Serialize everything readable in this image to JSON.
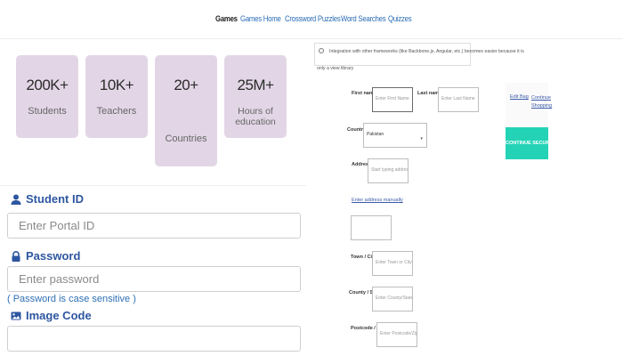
{
  "nav": {
    "links": [
      "Games",
      "Games Home",
      "Crossword Puzzles",
      "Word Searches",
      "Quizzes"
    ]
  },
  "stats": [
    {
      "value": "200K+",
      "label": "Students"
    },
    {
      "value": "10K+",
      "label": "Teachers"
    },
    {
      "value": "20+",
      "label": "Countries"
    },
    {
      "value": "25M+",
      "label": "Hours of education"
    }
  ],
  "login": {
    "student_id_label": "Student ID",
    "student_id_placeholder": "Enter Portal ID",
    "password_label": "Password",
    "password_placeholder": "Enter password",
    "password_hint": "( Password is case sensitive )",
    "image_code_label": "Image Code",
    "image_code_value": ""
  },
  "checkout": {
    "note_line1": "Integration with other frameworks (like Backbone.js, Angular, etc.) becomes easier because it is",
    "note_line2": "only a view library",
    "first_name_label": "First name *",
    "first_name_placeholder": "Enter First Name",
    "last_name_label": "Last name *",
    "last_name_placeholder": "Enter Last Name",
    "edit_bag": "Edit Bag",
    "continue_shopping": "Continue Shopping",
    "continue_securely": "CONTINUE SECURELY",
    "country_label": "Country",
    "country_value": "Pakistan",
    "address_label": "Address *",
    "address_placeholder": "Start typing address",
    "enter_address_manually": "Enter address manually",
    "town_label": "Town / City *",
    "town_placeholder": "Enter Town or City",
    "county_label": "County / State",
    "county_placeholder": "Enter County/State",
    "postcode_label": "Postcode / Zip *",
    "postcode_placeholder": "Enter Postcode/Zip"
  },
  "colors": {
    "stat_card": "#e2d6e6",
    "label_blue": "#2d56a0",
    "cta_green": "#24d3b6"
  }
}
